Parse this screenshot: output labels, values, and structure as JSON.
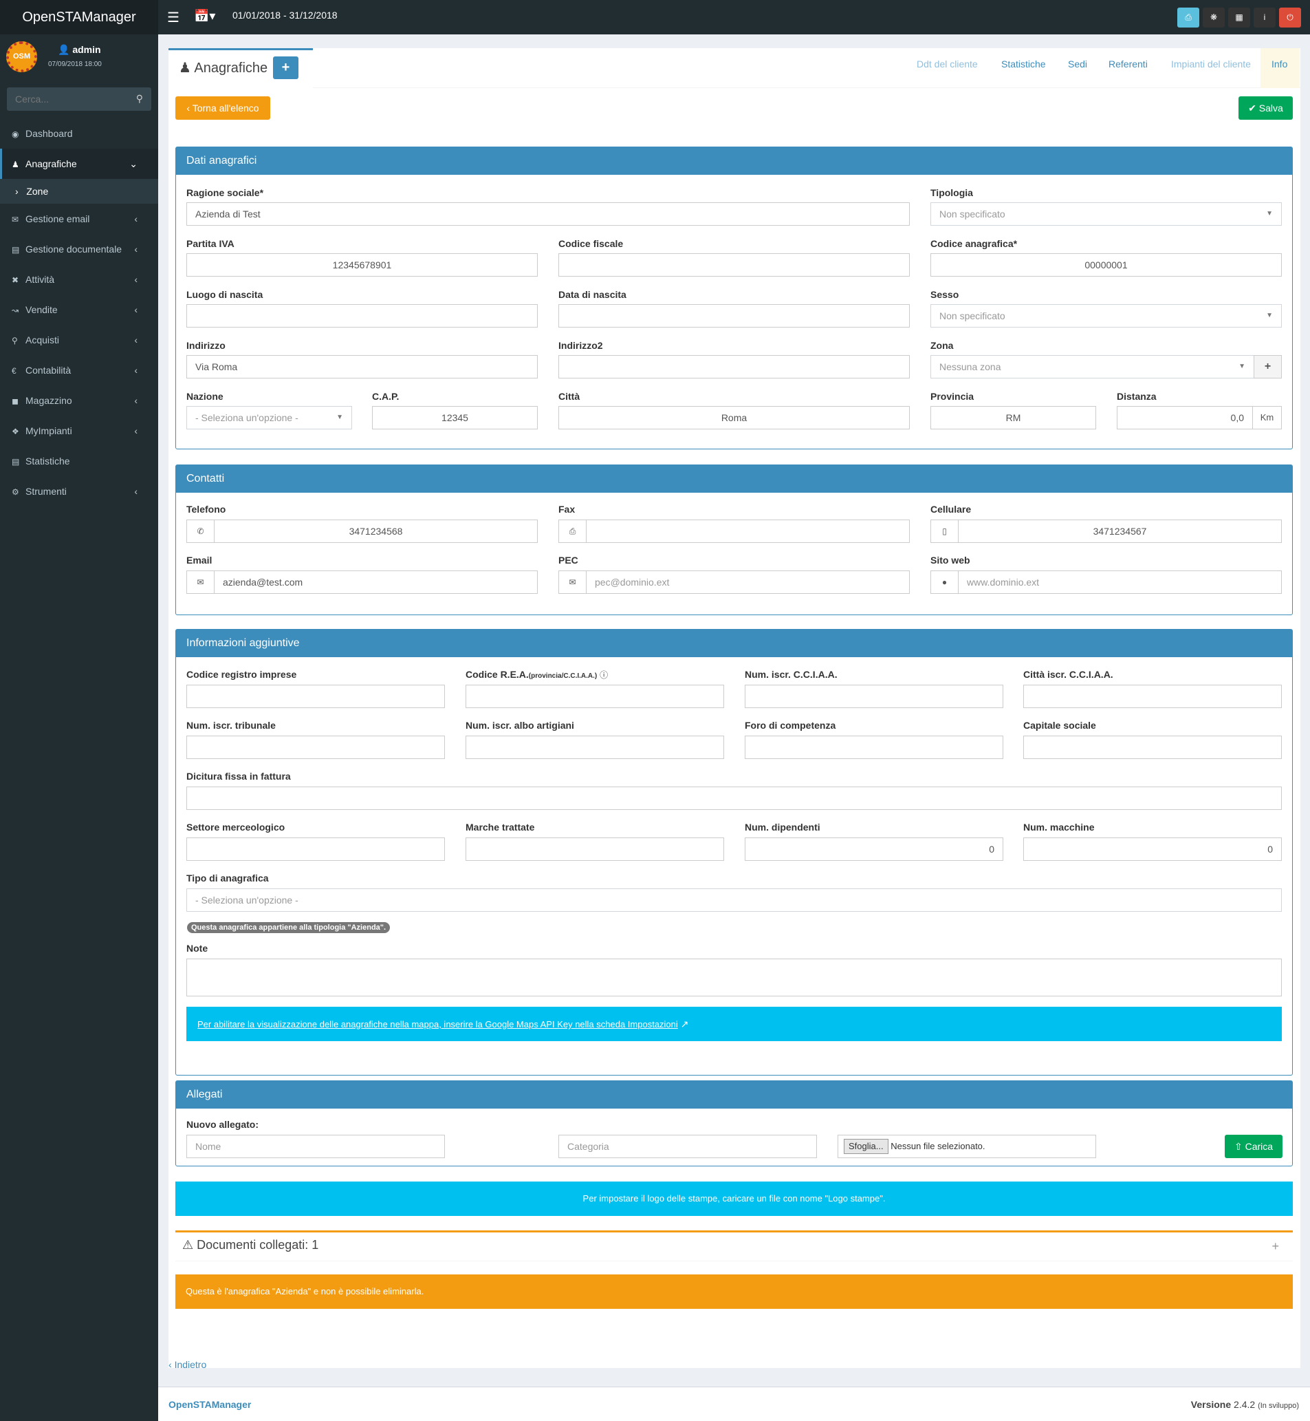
{
  "app": {
    "title": "OpenSTAManager",
    "period": "01/01/2018 - 31/12/2018"
  },
  "user": {
    "name": "admin",
    "date": "07/09/2018 18:00",
    "logo_text": "OSM"
  },
  "search": {
    "placeholder": "Cerca..."
  },
  "sidebar": {
    "items": [
      {
        "label": "Dashboard",
        "icon": "dashboard-icon"
      },
      {
        "label": "Anagrafiche",
        "icon": "users-icon"
      },
      {
        "label": "Zone",
        "icon": "chevron-right-icon"
      },
      {
        "label": "Gestione email",
        "icon": "envelope-icon"
      },
      {
        "label": "Gestione documentale",
        "icon": "file-icon"
      },
      {
        "label": "Attività",
        "icon": "wrench-icon"
      },
      {
        "label": "Vendite",
        "icon": "line-chart-icon"
      },
      {
        "label": "Acquisti",
        "icon": "cart-icon"
      },
      {
        "label": "Contabilità",
        "icon": "euro-icon"
      },
      {
        "label": "Magazzino",
        "icon": "truck-icon"
      },
      {
        "label": "MyImpianti",
        "icon": "puzzle-icon"
      },
      {
        "label": "Statistiche",
        "icon": "bar-chart-icon"
      },
      {
        "label": "Strumenti",
        "icon": "gear-icon"
      }
    ]
  },
  "page": {
    "title": "Anagrafiche",
    "back_list": "Torna all'elenco",
    "save": "Salva",
    "back": "Indietro"
  },
  "tabs": [
    "Ddt del cliente",
    "Statistiche",
    "Sedi",
    "Referenti",
    "Impianti del cliente",
    "Info"
  ],
  "dati": {
    "header": "Dati anagrafici",
    "ragione_sociale": {
      "label": "Ragione sociale*",
      "value": "Azienda di Test"
    },
    "tipologia": {
      "label": "Tipologia",
      "value": "Non specificato"
    },
    "partita_iva": {
      "label": "Partita IVA",
      "value": "12345678901"
    },
    "codice_fiscale": {
      "label": "Codice fiscale",
      "value": ""
    },
    "codice_anagrafica": {
      "label": "Codice anagrafica*",
      "value": "00000001"
    },
    "luogo_nascita": {
      "label": "Luogo di nascita",
      "value": ""
    },
    "data_nascita": {
      "label": "Data di nascita",
      "value": ""
    },
    "sesso": {
      "label": "Sesso",
      "value": "Non specificato"
    },
    "indirizzo": {
      "label": "Indirizzo",
      "value": "Via Roma"
    },
    "indirizzo2": {
      "label": "Indirizzo2",
      "value": ""
    },
    "zona": {
      "label": "Zona",
      "value": "Nessuna zona"
    },
    "nazione": {
      "label": "Nazione",
      "value": "- Seleziona un'opzione -"
    },
    "cap": {
      "label": "C.A.P.",
      "value": "12345"
    },
    "citta": {
      "label": "Città",
      "value": "Roma"
    },
    "provincia": {
      "label": "Provincia",
      "value": "RM"
    },
    "distanza": {
      "label": "Distanza",
      "value": "0,0",
      "unit": "Km"
    }
  },
  "contatti": {
    "header": "Contatti",
    "telefono": {
      "label": "Telefono",
      "value": "3471234568"
    },
    "fax": {
      "label": "Fax",
      "value": ""
    },
    "cellulare": {
      "label": "Cellulare",
      "value": "3471234567"
    },
    "email": {
      "label": "Email",
      "value": "azienda@test.com"
    },
    "pec": {
      "label": "PEC",
      "placeholder": "pec@dominio.ext"
    },
    "sito": {
      "label": "Sito web",
      "placeholder": "www.dominio.ext"
    }
  },
  "aggiuntive": {
    "header": "Informazioni aggiuntive",
    "registro": {
      "label": "Codice registro imprese"
    },
    "rea": {
      "label": "Codice R.E.A.",
      "hint": "(provincia/C.C.I.A.A.)"
    },
    "cciaa": {
      "label": "Num. iscr. C.C.I.A.A."
    },
    "citta_cciaa": {
      "label": "Città iscr. C.C.I.A.A."
    },
    "tribunale": {
      "label": "Num. iscr. tribunale"
    },
    "artigiani": {
      "label": "Num. iscr. albo artigiani"
    },
    "foro": {
      "label": "Foro di competenza"
    },
    "capitale": {
      "label": "Capitale sociale"
    },
    "dicitura": {
      "label": "Dicitura fissa in fattura"
    },
    "settore": {
      "label": "Settore merceologico"
    },
    "marche": {
      "label": "Marche trattate"
    },
    "dipendenti": {
      "label": "Num. dipendenti",
      "value": "0"
    },
    "macchine": {
      "label": "Num. macchine",
      "value": "0"
    },
    "tipo": {
      "label": "Tipo di anagrafica",
      "value": "- Seleziona un'opzione -"
    },
    "badge": "Questa anagrafica appartiene alla tipologia \"Azienda\".",
    "note": {
      "label": "Note"
    },
    "maps_link": "Per abilitare la visualizzazione delle anagrafiche nella mappa, inserire la Google Maps API Key nella scheda Impostazioni"
  },
  "allegati": {
    "header": "Allegati",
    "label": "Nuovo allegato:",
    "nome_placeholder": "Nome",
    "categoria_placeholder": "Categoria",
    "browse": "Sfoglia...",
    "nofile": "Nessun file selezionato.",
    "upload": "Carica"
  },
  "logo_info": "Per impostare il logo delle stampe, caricare un file con nome \"Logo stampe\".",
  "documenti": {
    "label": "Documenti collegati: 1"
  },
  "warning": "Questa è l'anagrafica \"Azienda\" e non è possibile eliminarla.",
  "footer": {
    "brand": "OpenSTAManager",
    "version_label": "Versione",
    "version": "2.4.2",
    "note": "(In sviluppo)"
  },
  "colors": {
    "primary": "#3c8dbc",
    "success": "#00a65a",
    "warning": "#f39c12",
    "info": "#00c0ef",
    "danger": "#dd4b39",
    "sidebar": "#222d32"
  }
}
